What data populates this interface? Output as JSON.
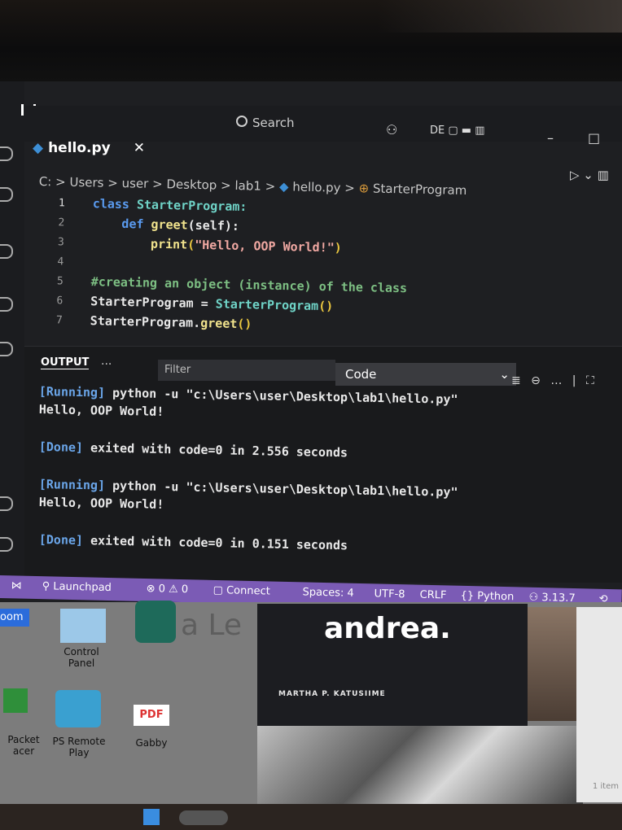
{
  "titlebar": {
    "search_label": "Search",
    "layout_icons": "DE",
    "minimize": "–",
    "maximize": "□"
  },
  "tab": {
    "filename": "hello.py",
    "close": "✕"
  },
  "breadcrumb": {
    "drive": "C:",
    "users": "Users",
    "user": "user",
    "desktop": "Desktop",
    "lab": "lab1",
    "file": "hello.py",
    "class": "StarterProgram",
    "sep": ">"
  },
  "editor": {
    "line_numbers": [
      "1",
      "2",
      "3",
      "4",
      "5",
      "6",
      "7"
    ],
    "lines": {
      "l1_kw": "class ",
      "l1_name": "StarterProgram:",
      "l2_kw": "    def ",
      "l2_fn": "greet",
      "l2_rest": "(self):",
      "l3_fn": "        print",
      "l3_open": "(",
      "l3_str": "\"Hello, OOP World!\"",
      "l3_close": ")",
      "l5": "#creating an object (instance) of the class",
      "l6_a": "StarterProgram = ",
      "l6_b": "StarterProgram",
      "l6_c": "()",
      "l7_a": "StarterProgram.",
      "l7_fn": "greet",
      "l7_c": "()"
    }
  },
  "panel": {
    "title": "OUTPUT",
    "more": "...",
    "filter_placeholder": "Filter",
    "channel": "Code",
    "output": [
      {
        "tag": "[Running]",
        "text": " python -u \"c:\\Users\\user\\Desktop\\lab1\\hello.py\""
      },
      {
        "tag": "",
        "text": "Hello, OOP World!"
      },
      {
        "tag": "[Done]",
        "text": " exited with code=0 in 2.556 seconds"
      },
      {
        "tag": "[Running]",
        "text": " python -u \"c:\\Users\\user\\Desktop\\lab1\\hello.py\""
      },
      {
        "tag": "",
        "text": "Hello, OOP World!"
      },
      {
        "tag": "[Done]",
        "text": " exited with code=0 in 0.151 seconds"
      }
    ]
  },
  "statusbar": {
    "launchpad": "Launchpad",
    "problems": "⊗ 0 ⚠ 0",
    "connect": "Connect",
    "spaces": "Spaces: 4",
    "encoding": "UTF-8",
    "eol": "CRLF",
    "language": "{} Python",
    "version": "3.13.7"
  },
  "desktop": {
    "control_panel": "Control Panel",
    "ps_remote": "PS Remote Play",
    "pdf": "PDF",
    "gabby": "Gabby",
    "packet": "Packet",
    "tracer": "acer",
    "book_title": "andrea.",
    "book_author": "MARTHA P. KATUSIIME",
    "item_count": "1 item",
    "overlay_text": "a Le",
    "zoom_label": "oom"
  }
}
